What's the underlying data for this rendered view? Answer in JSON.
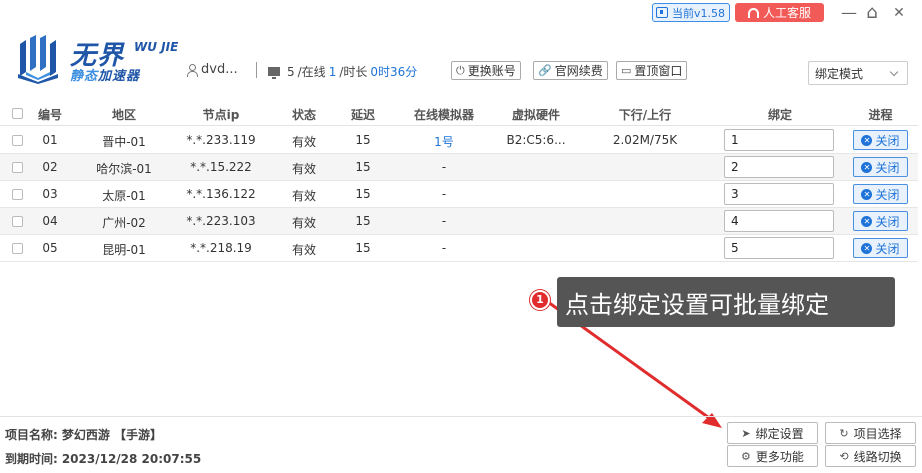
{
  "titlebar": {
    "version": "当前v1.58",
    "service": "人工客服",
    "min_icon": "—",
    "home_icon": "⌂",
    "close_icon": "✕"
  },
  "logo": {
    "title": "无界",
    "wu": "WU JIE",
    "sub_a": "静态",
    "sub_b": "加速器"
  },
  "header": {
    "username": "dvd...",
    "online_count": "5",
    "online_label": "/在线",
    "online_value": "1",
    "duration_label": "/时长",
    "duration_value": "0时36分",
    "buttons": {
      "switch_account": "更换账号",
      "renew": "官网续费",
      "pin_window": "置顶窗口"
    },
    "mode": "绑定模式"
  },
  "table": {
    "columns": [
      "编号",
      "地区",
      "节点ip",
      "状态",
      "延迟",
      "在线模拟器",
      "虚拟硬件",
      "下行/上行",
      "绑定",
      "进程"
    ],
    "rows": [
      {
        "no": "01",
        "region": "晋中-01",
        "ip": "*.*.233.119",
        "status": "有效",
        "latency": "15",
        "emulator": "1号",
        "hardware": "B2:C5:6...",
        "speed": "2.02M/75K",
        "bind": "1",
        "action": "关闭"
      },
      {
        "no": "02",
        "region": "哈尔滨-01",
        "ip": "*.*.15.222",
        "status": "有效",
        "latency": "15",
        "emulator": "-",
        "hardware": "",
        "speed": "",
        "bind": "2",
        "action": "关闭"
      },
      {
        "no": "03",
        "region": "太原-01",
        "ip": "*.*.136.122",
        "status": "有效",
        "latency": "15",
        "emulator": "-",
        "hardware": "",
        "speed": "",
        "bind": "3",
        "action": "关闭"
      },
      {
        "no": "04",
        "region": "广州-02",
        "ip": "*.*.223.103",
        "status": "有效",
        "latency": "15",
        "emulator": "-",
        "hardware": "",
        "speed": "",
        "bind": "4",
        "action": "关闭"
      },
      {
        "no": "05",
        "region": "昆明-01",
        "ip": "*.*.218.19",
        "status": "有效",
        "latency": "15",
        "emulator": "-",
        "hardware": "",
        "speed": "",
        "bind": "5",
        "action": "关闭"
      }
    ]
  },
  "annotation": {
    "badge": "1",
    "text": "点击绑定设置可批量绑定"
  },
  "footer": {
    "project_label": "项目名称:",
    "project_value": "梦幻西游 【手游】",
    "expire_label": "到期时间:",
    "expire_value": "2023/12/28 20:07:55",
    "buttons": {
      "bind_settings": "绑定设置",
      "project_select": "项目选择",
      "more": "更多功能",
      "line_switch": "线路切换"
    }
  },
  "colors": {
    "accent": "#1e73d8",
    "service": "#f15a57",
    "callout": "#555555",
    "arrow": "#e02c2c"
  }
}
